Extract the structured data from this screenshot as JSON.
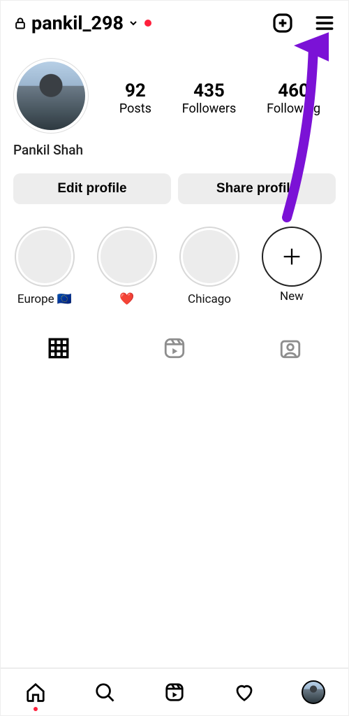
{
  "header": {
    "username": "pankil_298"
  },
  "profile": {
    "display_name": "Pankil Shah",
    "stats": {
      "posts": {
        "value": "92",
        "label": "Posts"
      },
      "followers": {
        "value": "435",
        "label": "Followers"
      },
      "following": {
        "value": "460",
        "label": "Following"
      }
    }
  },
  "buttons": {
    "edit": "Edit profile",
    "share": "Share profile"
  },
  "highlights": [
    {
      "label": "Europe 🇪🇺"
    },
    {
      "label": "❤️"
    },
    {
      "label": "Chicago"
    }
  ],
  "highlight_new_label": "New"
}
